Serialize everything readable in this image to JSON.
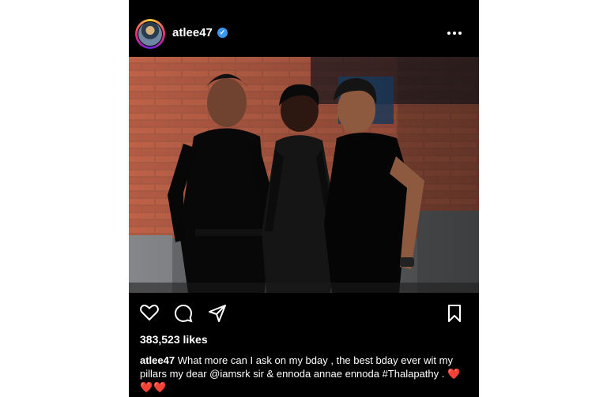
{
  "post": {
    "username": "atlee47",
    "verified_icon": "verified-badge-icon",
    "more_icon": "more-options-icon",
    "photo_description_icon": "group-photo"
  },
  "actions": {
    "like_icon": "heart-icon",
    "comment_icon": "comment-icon",
    "share_icon": "share-icon",
    "save_icon": "bookmark-icon"
  },
  "likes": "383,523 likes",
  "caption": {
    "username": "atlee47",
    "text": "What more can I ask on my bday , the best bday ever wit my pillars my  dear  @iamsrk sir & ennoda annae ennoda #Thalapathy .",
    "hearts": "❤️❤️❤️"
  },
  "colors": {
    "background": "#000000",
    "text": "#ffffff",
    "verified": "#3897f0"
  }
}
